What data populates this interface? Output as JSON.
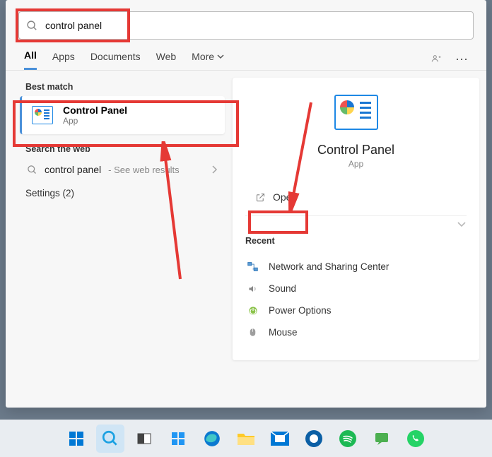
{
  "search": {
    "query": "control panel"
  },
  "tabs": {
    "all": "All",
    "apps": "Apps",
    "documents": "Documents",
    "web": "Web",
    "more": "More"
  },
  "left": {
    "best_match_label": "Best match",
    "best_match": {
      "title": "Control Panel",
      "subtitle": "App"
    },
    "search_web_label": "Search the web",
    "web_item": {
      "text": "control panel",
      "hint": "- See web results"
    },
    "settings": "Settings (2)"
  },
  "right": {
    "title": "Control Panel",
    "subtitle": "App",
    "open": "Open",
    "recent_label": "Recent",
    "recent": [
      {
        "label": "Network and Sharing Center"
      },
      {
        "label": "Sound"
      },
      {
        "label": "Power Options"
      },
      {
        "label": "Mouse"
      }
    ]
  },
  "colors": {
    "annotation": "#e53935",
    "accent": "#4a90d9"
  }
}
